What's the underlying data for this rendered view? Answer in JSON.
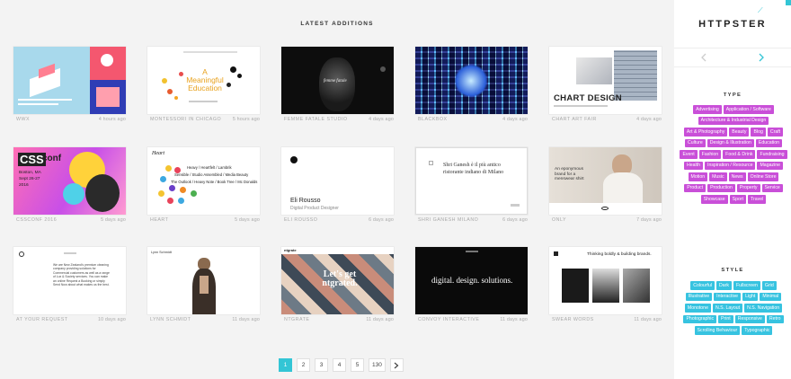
{
  "heading": "LATEST ADDITIONS",
  "cards": [
    {
      "title": "WWX",
      "age": "4 hours ago"
    },
    {
      "title": "MONTESSORI IN CHICAGO",
      "age": "5 hours ago"
    },
    {
      "title": "FEMME FATALE STUDIO",
      "age": "4 days ago"
    },
    {
      "title": "BLACKBOX",
      "age": "4 days ago"
    },
    {
      "title": "CHART ART FAIR",
      "age": "4 days ago"
    },
    {
      "title": "CSSCONF 2016",
      "age": "5 days ago"
    },
    {
      "title": "HEART",
      "age": "5 days ago"
    },
    {
      "title": "ELI ROUSSO",
      "age": "6 days ago"
    },
    {
      "title": "SHRI GANESH MILANO",
      "age": "6 days ago"
    },
    {
      "title": "ONLY",
      "age": "7 days ago"
    },
    {
      "title": "AT YOUR REQUEST",
      "age": "10 days ago"
    },
    {
      "title": "LYNN SCHMIDT",
      "age": "11 days ago"
    },
    {
      "title": "NTGRATE",
      "age": "11 days ago"
    },
    {
      "title": "CONVOY INTERACTIVE",
      "age": "11 days ago"
    },
    {
      "title": "SWEAR WORDS",
      "age": "11 days ago"
    }
  ],
  "thumbs": {
    "montessori": "A Meaningful Education",
    "chart": "CHART DESIGN",
    "css": "CSS",
    "css_sub": "conf",
    "css_city": "Boston, MA",
    "css_date": "Sept 26-27",
    "css_year": "2016",
    "eli_name": "Eli Rousso",
    "eli_role": "Digital Product Designer",
    "shri_line1": "Shri Ganesh è il più antico",
    "shri_line2": "ristorante indiano di Milano",
    "only_text": "An eponymous brand for a menswear shirt",
    "heart_logo": "Heart",
    "heart_line1": "Heavy / Heartfelt / Lambrik",
    "heart_line2": "Sensible / Studio Assembled / Media Beauty",
    "heart_line3": "The Outlook / Heavy Note / Book Tree / Mc Donalds",
    "ntgrate": "Let's get ntgrated.",
    "convoy": "digital. design. solutions.",
    "swear": "Thinking boldly & building brands.",
    "request_body": "We are New Zealand's premium cleaning company providing solutions for Commercial customers as well as a range of Lux & Society services. You can make an online Request a Booking or simply Send Now about what makes us the best.",
    "femme_title": "femme fatale",
    "lynn_title": "Lynn Schmidt",
    "ntgrate_logo": "ntgrate"
  },
  "pagination": {
    "pages": [
      "1",
      "2",
      "3",
      "4",
      "5",
      "130"
    ],
    "active": "1",
    "next_icon": "chevron-right-icon"
  },
  "sidebar": {
    "logo": "HTTPSTER",
    "type_title": "TYPE",
    "type_tags": [
      "Advertising",
      "Application / Software",
      "Architecture & Industrial Design",
      "Art & Photography",
      "Beauty",
      "Blog",
      "Craft",
      "Culture",
      "Design & Illustration",
      "Education",
      "Event",
      "Fashion",
      "Food & Drink",
      "Fundraising",
      "Health",
      "Inspiration / Resource",
      "Magazine",
      "Motion",
      "Music",
      "News",
      "Online Store",
      "Product",
      "Production",
      "Property",
      "Service",
      "Showcase",
      "Sport",
      "Travel"
    ],
    "style_title": "STYLE",
    "style_tags": [
      "Colourful",
      "Dark",
      "Fullscreen",
      "Grid",
      "Illustrative",
      "Interactive",
      "Light",
      "Minimal",
      "Monotone",
      "N.S. Layout",
      "N.S. Navigation",
      "Photographic",
      "Print",
      "Responsive",
      "Retro",
      "Scrolling Behaviour",
      "Typographic"
    ],
    "accent_type": "#c94fd8",
    "accent_style": "#37c3e0",
    "accent_brand": "#33c5d5"
  }
}
